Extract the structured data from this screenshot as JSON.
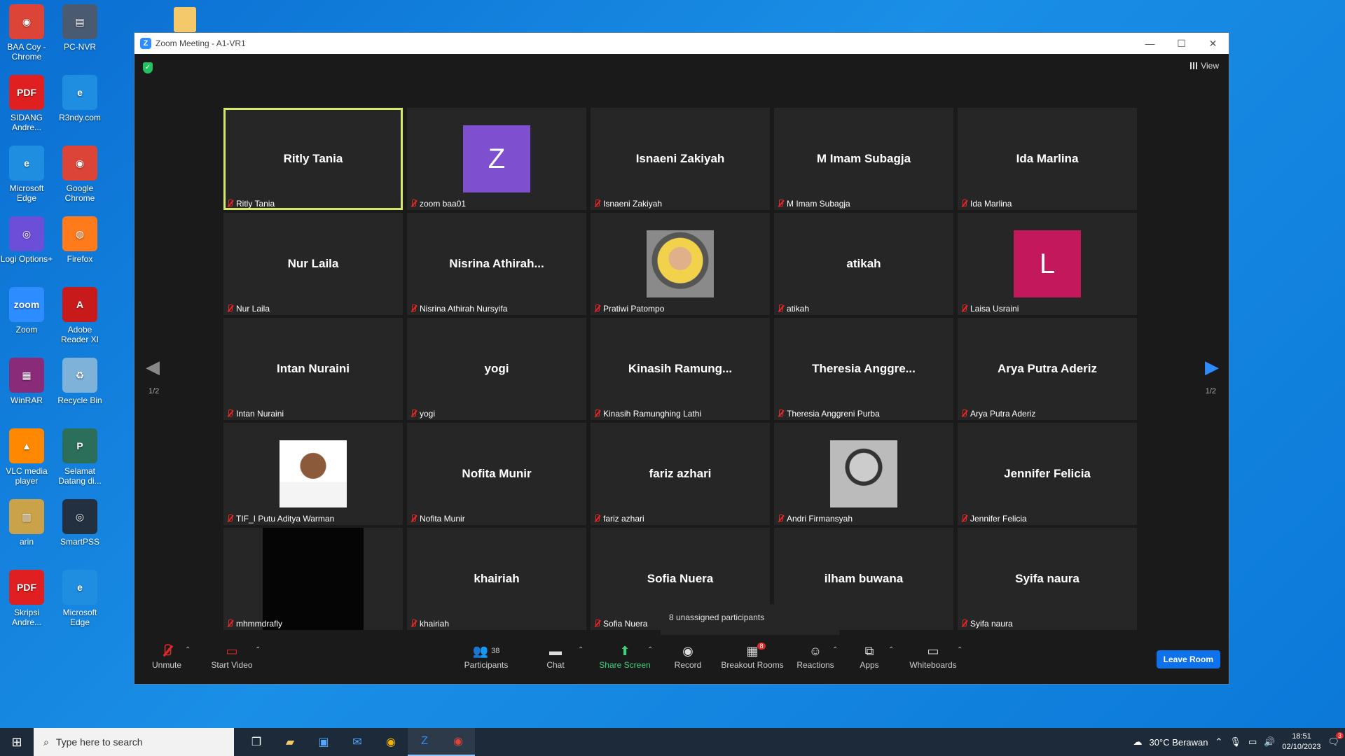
{
  "desktop": {
    "icons": [
      {
        "label": "BAA Coy - Chrome",
        "color": "#db4437",
        "glyph": "◉"
      },
      {
        "label": "PC-NVR",
        "color": "#4a5a70",
        "glyph": "▤"
      },
      {
        "label": "SIDANG Andre...",
        "color": "#e02020",
        "glyph": "PDF"
      },
      {
        "label": "R3ndy.com",
        "color": "#1f8de0",
        "glyph": "e"
      },
      {
        "label": "Microsoft Edge",
        "color": "#1f8de0",
        "glyph": "e"
      },
      {
        "label": "Google Chrome",
        "color": "#db4437",
        "glyph": "◉"
      },
      {
        "label": "Logi Options+",
        "color": "#6b4fd8",
        "glyph": "◎"
      },
      {
        "label": "Firefox",
        "color": "#ff7a1a",
        "glyph": "◍"
      },
      {
        "label": "Zoom",
        "color": "#2d8cff",
        "glyph": "zoom"
      },
      {
        "label": "Adobe Reader XI",
        "color": "#c81a1a",
        "glyph": "A"
      },
      {
        "label": "WinRAR",
        "color": "#8a2b7a",
        "glyph": "▦"
      },
      {
        "label": "Recycle Bin",
        "color": "#7fb2d8",
        "glyph": "♻"
      },
      {
        "label": "VLC media player",
        "color": "#ff8800",
        "glyph": "▲"
      },
      {
        "label": "Selamat Datang di...",
        "color": "#2b6e5a",
        "glyph": "P"
      },
      {
        "label": "arin",
        "color": "#c9a24a",
        "glyph": "▥"
      },
      {
        "label": "SmartPSS",
        "color": "#22303f",
        "glyph": "◎"
      },
      {
        "label": "Skripsi Andre...",
        "color": "#e02020",
        "glyph": "PDF"
      },
      {
        "label": "Microsoft Edge",
        "color": "#1f8de0",
        "glyph": "e"
      }
    ]
  },
  "window": {
    "title": "Zoom Meeting - A1-VR1",
    "controls": {
      "minimize": "—",
      "maximize": "☐",
      "close": "✕"
    }
  },
  "meeting": {
    "view_label": "View",
    "page_left": "1/2",
    "page_right": "1/2",
    "tiles": [
      {
        "display": "Ritly Tania",
        "name": "Ritly Tania",
        "kind": "text",
        "active": true
      },
      {
        "display": "Z",
        "name": "zoom baa01",
        "kind": "avatar",
        "avatar_color": "#7e4fce"
      },
      {
        "display": "Isnaeni Zakiyah",
        "name": "Isnaeni Zakiyah",
        "kind": "text"
      },
      {
        "display": "M Imam Subagja",
        "name": "M Imam Subagja",
        "kind": "text"
      },
      {
        "display": "Ida Marlina",
        "name": "Ida Marlina",
        "kind": "text"
      },
      {
        "display": "Nur Laila",
        "name": "Nur Laila",
        "kind": "text"
      },
      {
        "display": "Nisrina  Athirah...",
        "name": "Nisrina Athirah Nursyifa",
        "kind": "text"
      },
      {
        "display": "",
        "name": "Pratiwi Patompo",
        "kind": "photo",
        "photo": "hijab"
      },
      {
        "display": "atikah",
        "name": "atikah",
        "kind": "text"
      },
      {
        "display": "L",
        "name": "Laisa Usraini",
        "kind": "avatar",
        "avatar_color": "#c4185c"
      },
      {
        "display": "Intan Nuraini",
        "name": "Intan Nuraini",
        "kind": "text"
      },
      {
        "display": "yogi",
        "name": "yogi",
        "kind": "text"
      },
      {
        "display": "Kinasih  Ramung...",
        "name": "Kinasih Ramunghing Lathi",
        "kind": "text"
      },
      {
        "display": "Theresia  Anggre...",
        "name": "Theresia Anggreni Purba",
        "kind": "text"
      },
      {
        "display": "Arya Putra Aderiz",
        "name": "Arya Putra Aderiz",
        "kind": "text"
      },
      {
        "display": "",
        "name": "TIF_I Putu Aditya Warman",
        "kind": "photo",
        "photo": "man"
      },
      {
        "display": "Nofita Munir",
        "name": "Nofita Munir",
        "kind": "text"
      },
      {
        "display": "fariz azhari",
        "name": "fariz azhari",
        "kind": "text"
      },
      {
        "display": "",
        "name": "Andri Firmansyah",
        "kind": "photo",
        "photo": "bw"
      },
      {
        "display": "Jennifer Felicia",
        "name": "Jennifer Felicia",
        "kind": "text"
      },
      {
        "display": "",
        "name": "mhmmdrafly",
        "kind": "black"
      },
      {
        "display": "khairiah",
        "name": "khairiah",
        "kind": "text"
      },
      {
        "display": "Sofia Nuera",
        "name": "Sofia Nuera",
        "kind": "text"
      },
      {
        "display": "ilham buwana",
        "name": "ilham buwana",
        "kind": "text",
        "name_visible": "na"
      },
      {
        "display": "Syifa naura",
        "name": "Syifa naura",
        "kind": "text"
      }
    ],
    "tooltip": "8 unassigned participants"
  },
  "toolbar": {
    "unmute": "Unmute",
    "start_video": "Start Video",
    "participants": "Participants",
    "participants_count": "38",
    "chat": "Chat",
    "share_screen": "Share Screen",
    "record": "Record",
    "breakout_rooms": "Breakout Rooms",
    "breakout_badge": "8",
    "reactions": "Reactions",
    "apps": "Apps",
    "whiteboards": "Whiteboards",
    "leave_room": "Leave Room"
  },
  "taskbar": {
    "search_placeholder": "Type here to search",
    "weather": "30°C  Berawan",
    "time": "18:51",
    "date": "02/10/2023",
    "notifications": "3"
  }
}
